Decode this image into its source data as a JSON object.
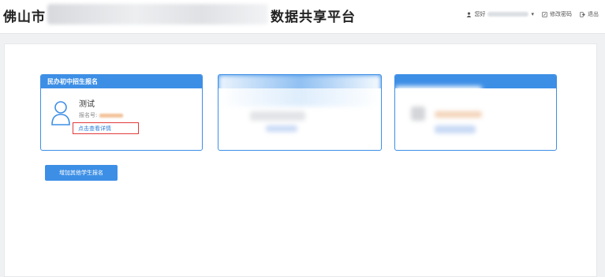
{
  "header": {
    "title_prefix": "佛山市",
    "title_suffix": "数据共享平台",
    "user_greeting": "您好",
    "change_password": "修改密码",
    "logout": "退出"
  },
  "cards": [
    {
      "header": "民办初中招生报名",
      "student_name": "测试",
      "reg_label": "报名号:",
      "detail_link": "点击查看详情"
    }
  ],
  "add_button": "增加其他学生报名",
  "colors": {
    "primary": "#3d8fe6",
    "highlight": "#e23a3a"
  }
}
